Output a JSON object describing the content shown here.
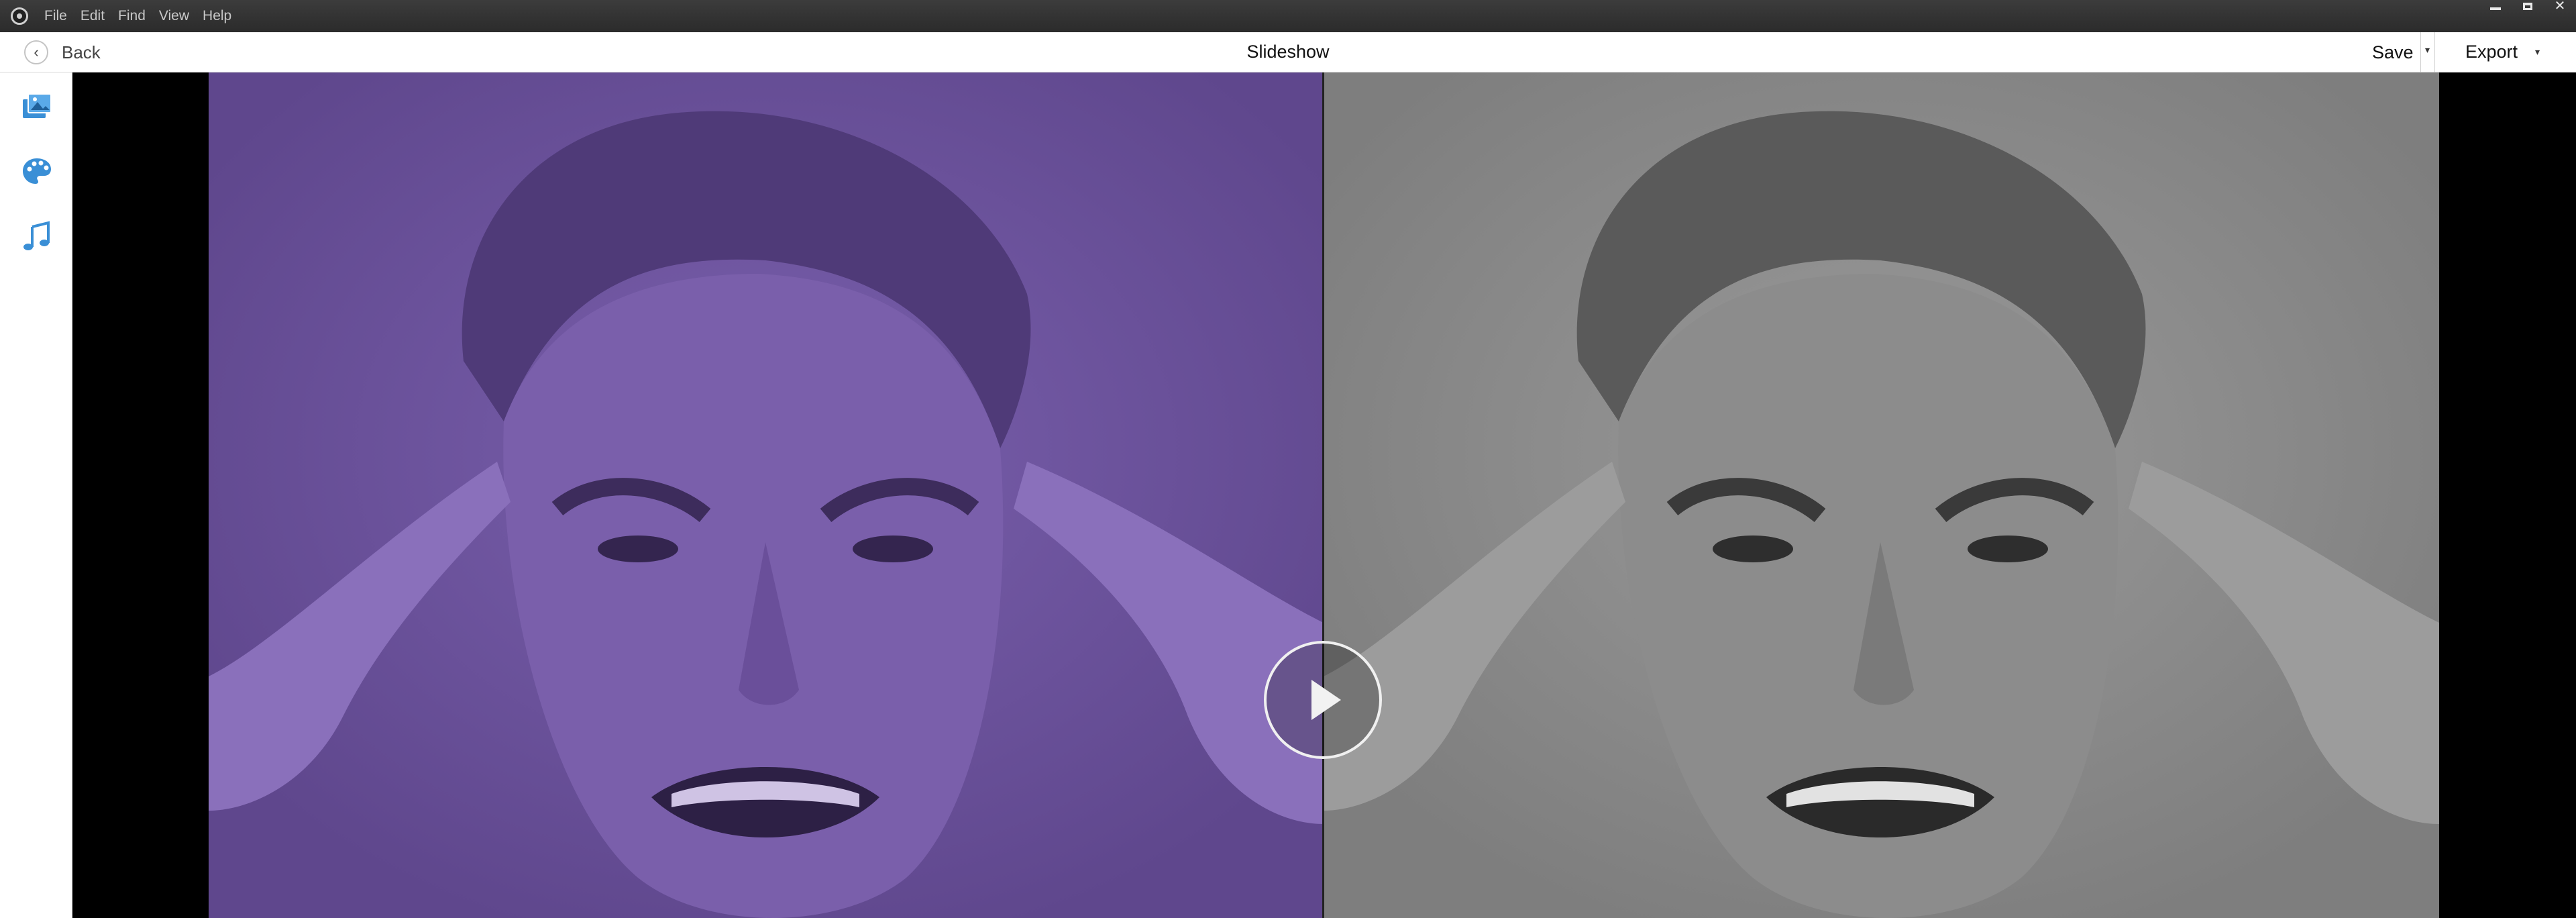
{
  "menubar": {
    "items": [
      "File",
      "Edit",
      "Find",
      "View",
      "Help"
    ]
  },
  "window_controls": {
    "close_glyph": "✕"
  },
  "toolbar": {
    "back_label": "Back",
    "title": "Slideshow",
    "save_label": "Save",
    "export_label": "Export",
    "dropdown_glyph": "▾",
    "back_glyph": "‹"
  },
  "siderail": {
    "icons": [
      "slides-icon",
      "palette-icon",
      "music-note-icon"
    ]
  },
  "stage": {
    "left_filter_color": "#6a4f9a",
    "right_filter_color": "#8f8f8f",
    "play_icon": "play-icon"
  },
  "colors": {
    "accent": "#3a8fd6",
    "titlebar": "#333333"
  }
}
